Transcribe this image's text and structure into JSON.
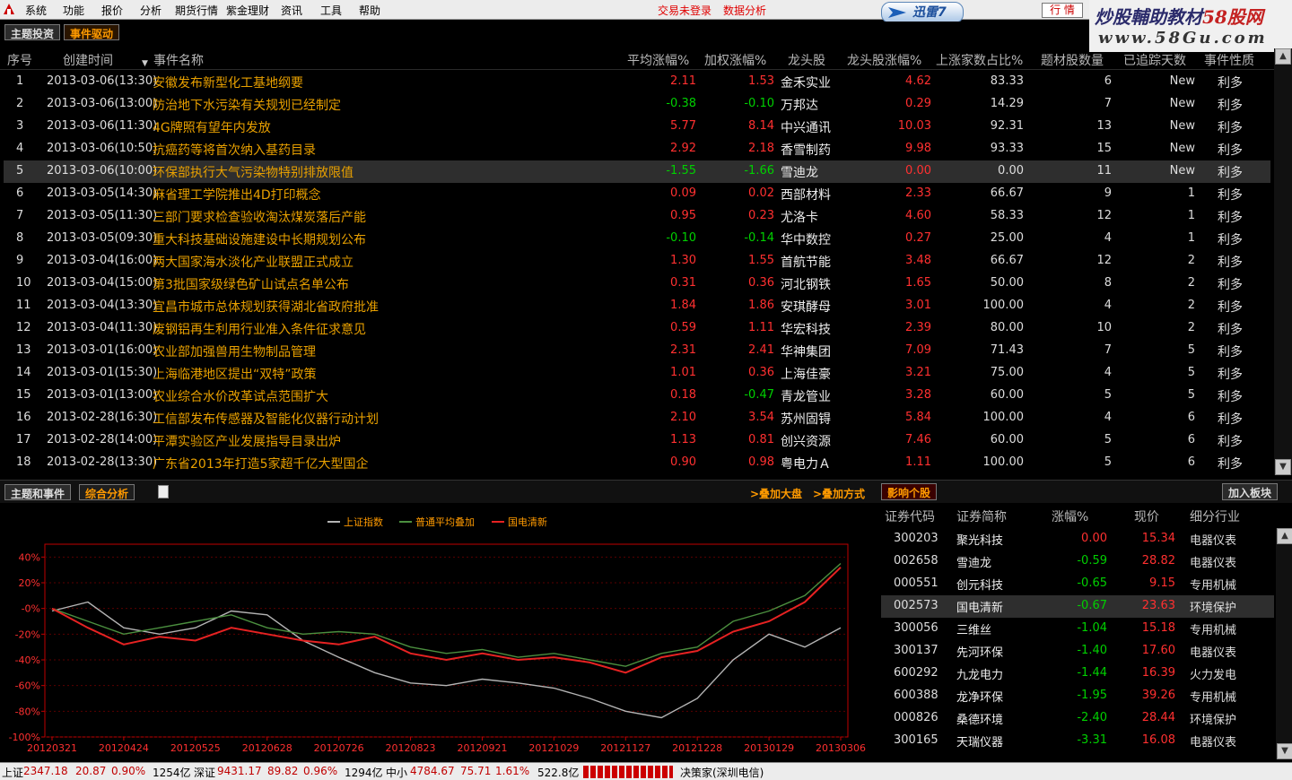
{
  "menubar": {
    "items": [
      "系统",
      "功能",
      "报价",
      "分析",
      "期货行情",
      "紫金理财",
      "资讯",
      "工具",
      "帮助"
    ],
    "trade_status": "交易未登录",
    "data_analysis": "数据分析",
    "xunlei": "迅雷7",
    "hq_button": "行  情"
  },
  "watermark": {
    "line1_a": "炒股輔助教材",
    "line1_b": "58股网",
    "line2": "www.58Gu.com"
  },
  "tabs": {
    "theme": "主题投资",
    "event": "事件驱动"
  },
  "table": {
    "headers": {
      "no": "序号",
      "time": "创建时间",
      "name": "事件名称",
      "avg": "平均涨幅%",
      "weighted": "加权涨幅%",
      "leader": "龙头股",
      "leader_pct": "龙头股涨幅%",
      "up_ratio": "上涨家数占比%",
      "count": "题材股数量",
      "days": "已追踪天数",
      "type": "事件性质"
    },
    "rows": [
      {
        "no": "1",
        "time": "2013-03-06(13:30)",
        "name": "安徽发布新型化工基地纲要",
        "avg": "2.11",
        "weighted": "1.53",
        "leader": "金禾实业",
        "leader_pct": "4.62",
        "up": "83.33",
        "count": "6",
        "days": "New",
        "type": "利多"
      },
      {
        "no": "2",
        "time": "2013-03-06(13:00)",
        "name": "防治地下水污染有关规划已经制定",
        "avg": "-0.38",
        "weighted": "-0.10",
        "leader": "万邦达",
        "leader_pct": "0.29",
        "up": "14.29",
        "count": "7",
        "days": "New",
        "type": "利多"
      },
      {
        "no": "3",
        "time": "2013-03-06(11:30)",
        "name": "4G牌照有望年内发放",
        "avg": "5.77",
        "weighted": "8.14",
        "leader": "中兴通讯",
        "leader_pct": "10.03",
        "up": "92.31",
        "count": "13",
        "days": "New",
        "type": "利多"
      },
      {
        "no": "4",
        "time": "2013-03-06(10:50)",
        "name": "抗癌药等将首次纳入基药目录",
        "avg": "2.92",
        "weighted": "2.18",
        "leader": "香雪制药",
        "leader_pct": "9.98",
        "up": "93.33",
        "count": "15",
        "days": "New",
        "type": "利多"
      },
      {
        "no": "5",
        "time": "2013-03-06(10:00)",
        "name": "环保部执行大气污染物特别排放限值",
        "avg": "-1.55",
        "weighted": "-1.66",
        "leader": "雪迪龙",
        "leader_pct": "0.00",
        "up": "0.00",
        "count": "11",
        "days": "New",
        "type": "利多"
      },
      {
        "no": "6",
        "time": "2013-03-05(14:30)",
        "name": "麻省理工学院推出4D打印概念",
        "avg": "0.09",
        "weighted": "0.02",
        "leader": "西部材料",
        "leader_pct": "2.33",
        "up": "66.67",
        "count": "9",
        "days": "1",
        "type": "利多"
      },
      {
        "no": "7",
        "time": "2013-03-05(11:30)",
        "name": "三部门要求检查验收淘汰煤炭落后产能",
        "avg": "0.95",
        "weighted": "0.23",
        "leader": "尤洛卡",
        "leader_pct": "4.60",
        "up": "58.33",
        "count": "12",
        "days": "1",
        "type": "利多"
      },
      {
        "no": "8",
        "time": "2013-03-05(09:30)",
        "name": "重大科技基础设施建设中长期规划公布",
        "avg": "-0.10",
        "weighted": "-0.14",
        "leader": "华中数控",
        "leader_pct": "0.27",
        "up": "25.00",
        "count": "4",
        "days": "1",
        "type": "利多"
      },
      {
        "no": "9",
        "time": "2013-03-04(16:00)",
        "name": "两大国家海水淡化产业联盟正式成立",
        "avg": "1.30",
        "weighted": "1.55",
        "leader": "首航节能",
        "leader_pct": "3.48",
        "up": "66.67",
        "count": "12",
        "days": "2",
        "type": "利多"
      },
      {
        "no": "10",
        "time": "2013-03-04(15:00)",
        "name": "第3批国家级绿色矿山试点名单公布",
        "avg": "0.31",
        "weighted": "0.36",
        "leader": "河北钢铁",
        "leader_pct": "1.65",
        "up": "50.00",
        "count": "8",
        "days": "2",
        "type": "利多"
      },
      {
        "no": "11",
        "time": "2013-03-04(13:30)",
        "name": "宜昌市城市总体规划获得湖北省政府批准",
        "avg": "1.84",
        "weighted": "1.86",
        "leader": "安琪酵母",
        "leader_pct": "3.01",
        "up": "100.00",
        "count": "4",
        "days": "2",
        "type": "利多"
      },
      {
        "no": "12",
        "time": "2013-03-04(11:30)",
        "name": "废钢铝再生利用行业准入条件征求意见",
        "avg": "0.59",
        "weighted": "1.11",
        "leader": "华宏科技",
        "leader_pct": "2.39",
        "up": "80.00",
        "count": "10",
        "days": "2",
        "type": "利多"
      },
      {
        "no": "13",
        "time": "2013-03-01(16:00)",
        "name": "农业部加强兽用生物制品管理",
        "avg": "2.31",
        "weighted": "2.41",
        "leader": "华神集团",
        "leader_pct": "7.09",
        "up": "71.43",
        "count": "7",
        "days": "5",
        "type": "利多"
      },
      {
        "no": "14",
        "time": "2013-03-01(15:30)",
        "name": "上海临港地区提出“双特”政策",
        "avg": "1.01",
        "weighted": "0.36",
        "leader": "上海佳豪",
        "leader_pct": "3.21",
        "up": "75.00",
        "count": "4",
        "days": "5",
        "type": "利多"
      },
      {
        "no": "15",
        "time": "2013-03-01(13:00)",
        "name": "农业综合水价改革试点范围扩大",
        "avg": "0.18",
        "weighted": "-0.47",
        "leader": "青龙管业",
        "leader_pct": "3.28",
        "up": "60.00",
        "count": "5",
        "days": "5",
        "type": "利多"
      },
      {
        "no": "16",
        "time": "2013-02-28(16:30)",
        "name": "工信部发布传感器及智能化仪器行动计划",
        "avg": "2.10",
        "weighted": "3.54",
        "leader": "苏州固锝",
        "leader_pct": "5.84",
        "up": "100.00",
        "count": "4",
        "days": "6",
        "type": "利多"
      },
      {
        "no": "17",
        "time": "2013-02-28(14:00)",
        "name": "平潭实验区产业发展指导目录出炉",
        "avg": "1.13",
        "weighted": "0.81",
        "leader": "创兴资源",
        "leader_pct": "7.46",
        "up": "60.00",
        "count": "5",
        "days": "6",
        "type": "利多"
      },
      {
        "no": "18",
        "time": "2013-02-28(13:30)",
        "name": "广东省2013年打造5家超千亿大型国企",
        "avg": "0.90",
        "weighted": "0.98",
        "leader": "粤电力Ａ",
        "leader_pct": "1.11",
        "up": "100.00",
        "count": "5",
        "days": "6",
        "type": "利多"
      }
    ]
  },
  "midbar": {
    "tab1": "主题和事件",
    "tab2": "综合分析",
    "overlay_market": ">叠加大盘",
    "overlay_method": ">叠加方式",
    "impact": "影响个股",
    "add_block": "加入板块"
  },
  "stocks": {
    "headers": {
      "code": "证券代码",
      "name": "证券简称",
      "pct": "涨幅%",
      "price": "现价",
      "industry": "细分行业"
    },
    "rows": [
      {
        "code": "300203",
        "name": "聚光科技",
        "pct": "0.00",
        "price": "15.34",
        "industry": "电器仪表"
      },
      {
        "code": "002658",
        "name": "雪迪龙",
        "pct": "-0.59",
        "price": "28.82",
        "industry": "电器仪表"
      },
      {
        "code": "000551",
        "name": "创元科技",
        "pct": "-0.65",
        "price": "9.15",
        "industry": "专用机械"
      },
      {
        "code": "002573",
        "name": "国电清新",
        "pct": "-0.67",
        "price": "23.63",
        "industry": "环境保护"
      },
      {
        "code": "300056",
        "name": "三维丝",
        "pct": "-1.04",
        "price": "15.18",
        "industry": "专用机械"
      },
      {
        "code": "300137",
        "name": "先河环保",
        "pct": "-1.40",
        "price": "17.60",
        "industry": "电器仪表"
      },
      {
        "code": "600292",
        "name": "九龙电力",
        "pct": "-1.44",
        "price": "16.39",
        "industry": "火力发电"
      },
      {
        "code": "600388",
        "name": "龙净环保",
        "pct": "-1.95",
        "price": "39.26",
        "industry": "专用机械"
      },
      {
        "code": "000826",
        "name": "桑德环境",
        "pct": "-2.40",
        "price": "28.44",
        "industry": "环境保护"
      },
      {
        "code": "300165",
        "name": "天瑞仪器",
        "pct": "-3.31",
        "price": "16.08",
        "industry": "电器仪表"
      },
      {
        "code": "",
        "name": "",
        "pct": "",
        "price": "",
        "industry": ""
      }
    ]
  },
  "chart_data": {
    "type": "line",
    "legend": [
      "上证指数",
      "普通平均叠加",
      "国电清新"
    ],
    "colors": {
      "sh": "#b4b4b4",
      "avg": "#4b8f3f",
      "gdqx": "#e62222"
    },
    "x_ticks": [
      "20120321",
      "20120424",
      "20120525",
      "20120628",
      "20120726",
      "20120823",
      "20120921",
      "20121029",
      "20121127",
      "20121228",
      "20130129",
      "20130306"
    ],
    "y_ticks": [
      "40%",
      "20%",
      "-0%",
      "-20%",
      "-40%",
      "-60%",
      "-80%",
      "-100%"
    ],
    "ylim": [
      -100,
      50
    ],
    "series": [
      {
        "name": "上证指数",
        "x": [
          0,
          0.5,
          1,
          1.5,
          2,
          2.5,
          3,
          3.5,
          4,
          4.5,
          5,
          5.5,
          6,
          6.5,
          7,
          7.5,
          8,
          8.5,
          9,
          9.5,
          10,
          10.5,
          11
        ],
        "values": [
          -2,
          5,
          -15,
          -20,
          -15,
          -2,
          -5,
          -25,
          -38,
          -50,
          -58,
          -60,
          -55,
          -58,
          -62,
          -70,
          -80,
          -85,
          -70,
          -40,
          -20,
          -30,
          -15
        ]
      },
      {
        "name": "普通平均叠加",
        "x": [
          0,
          0.5,
          1,
          1.5,
          2,
          2.5,
          3,
          3.5,
          4,
          4.5,
          5,
          5.5,
          6,
          6.5,
          7,
          7.5,
          8,
          8.5,
          9,
          9.5,
          10,
          10.5,
          11
        ],
        "values": [
          0,
          -10,
          -20,
          -15,
          -10,
          -5,
          -15,
          -20,
          -18,
          -20,
          -30,
          -35,
          -32,
          -38,
          -35,
          -40,
          -45,
          -35,
          -30,
          -10,
          -2,
          10,
          35
        ]
      },
      {
        "name": "国电清新",
        "x": [
          0,
          0.5,
          1,
          1.5,
          2,
          2.5,
          3,
          3.5,
          4,
          4.5,
          5,
          5.5,
          6,
          6.5,
          7,
          7.5,
          8,
          8.5,
          9,
          9.5,
          10,
          10.5,
          11
        ],
        "values": [
          0,
          -15,
          -28,
          -22,
          -25,
          -15,
          -20,
          -25,
          -28,
          -22,
          -35,
          -40,
          -35,
          -40,
          -38,
          -42,
          -50,
          -38,
          -33,
          -18,
          -10,
          5,
          32
        ]
      }
    ]
  },
  "status": {
    "sh_label": "上证",
    "sh_val": "2347.18",
    "sh_chg": "20.87",
    "sh_pct": "0.90%",
    "sh_amt": "1254亿",
    "sz_label": "深证",
    "sz_val": "9431.17",
    "sz_chg": "89.82",
    "sz_pct": "0.96%",
    "sz_amt": "1294亿",
    "zx_label": "中小",
    "zx_val": "4784.67",
    "zx_chg": "75.71",
    "zx_pct": "1.61%",
    "zx_amt": "522.8亿",
    "broker": "决策家(深圳电信)"
  }
}
